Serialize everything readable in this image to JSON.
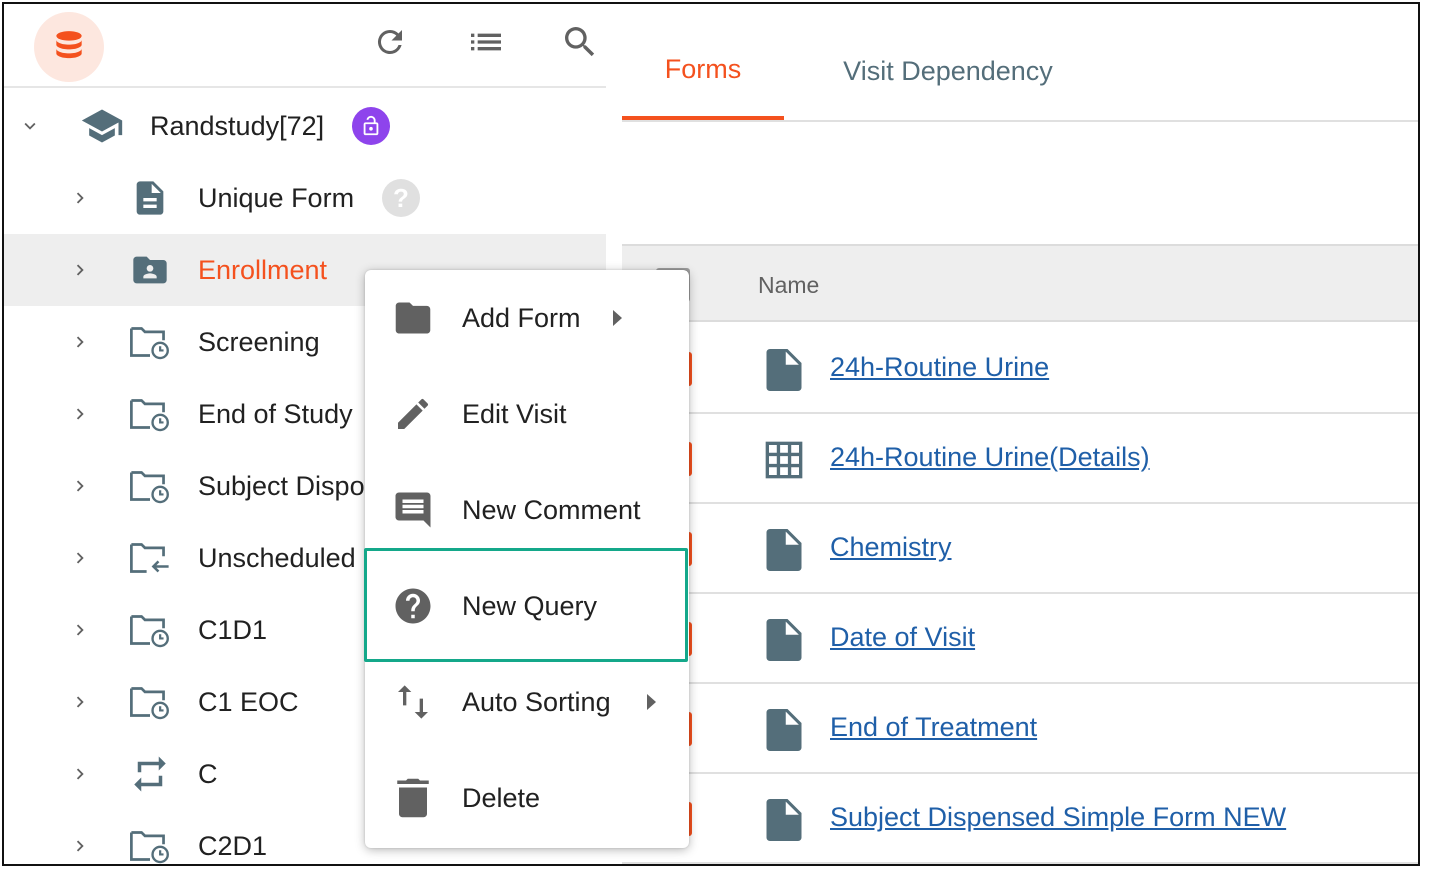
{
  "colors": {
    "accent": "#f4511e",
    "link": "#1f5fa8",
    "icon_gray": "#546e7a",
    "lock_badge": "#8e44ec",
    "highlight_border": "#14a88a"
  },
  "toolbar": {
    "logo_icon": "database-icon",
    "refresh_icon": "refresh-icon",
    "list_icon": "list-icon",
    "search_icon": "search-icon"
  },
  "tree": {
    "root": {
      "label": "Randstudy[72]",
      "icon": "school-icon",
      "badge": "lock-open-icon"
    },
    "items": [
      {
        "label": "Unique Form",
        "icon": "form-icon",
        "badge": "help-icon"
      },
      {
        "label": "Enrollment",
        "icon": "folder-user-icon",
        "selected": true
      },
      {
        "label": "Screening",
        "icon": "folder-clock-icon"
      },
      {
        "label": "End of Study",
        "icon": "folder-clock-icon"
      },
      {
        "label": "Subject Dispo",
        "icon": "folder-clock-icon"
      },
      {
        "label": "Unscheduled",
        "icon": "folder-arrow-icon"
      },
      {
        "label": "C1D1",
        "icon": "folder-clock-icon"
      },
      {
        "label": "C1 EOC",
        "icon": "folder-clock-icon"
      },
      {
        "label": "C",
        "icon": "repeat-icon"
      },
      {
        "label": "C2D1",
        "icon": "folder-clock-icon"
      }
    ]
  },
  "tabs": [
    {
      "label": "Forms",
      "active": true
    },
    {
      "label": "Visit Dependency",
      "active": false
    }
  ],
  "table": {
    "header_name": "Name",
    "rows": [
      {
        "name": "24h-Routine Urine",
        "icon": "file-icon"
      },
      {
        "name": "24h-Routine Urine(Details)",
        "icon": "grid-icon"
      },
      {
        "name": "Chemistry",
        "icon": "file-icon"
      },
      {
        "name": "Date of Visit",
        "icon": "file-icon"
      },
      {
        "name": "End of Treatment",
        "icon": "file-icon"
      },
      {
        "name": "Subject Dispensed Simple Form NEW",
        "icon": "file-icon"
      }
    ]
  },
  "context_menu": {
    "items": [
      {
        "label": "Add Form",
        "icon": "folder-icon",
        "submenu": true
      },
      {
        "label": "Edit Visit",
        "icon": "pencil-icon",
        "submenu": false
      },
      {
        "label": "New Comment",
        "icon": "comment-icon",
        "submenu": false
      },
      {
        "label": "New Query",
        "icon": "help-circle-icon",
        "submenu": false,
        "highlighted": true
      },
      {
        "label": "Auto Sorting",
        "icon": "sort-icon",
        "submenu": true
      },
      {
        "label": "Delete",
        "icon": "trash-icon",
        "submenu": false
      }
    ]
  }
}
